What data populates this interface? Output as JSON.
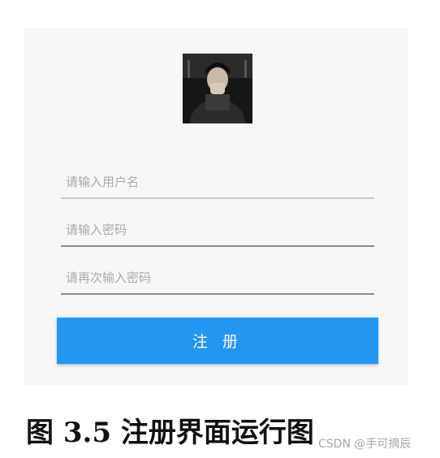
{
  "screen": {
    "avatar_icon": "user-photo",
    "username": {
      "placeholder": "请输入用户名",
      "value": ""
    },
    "password": {
      "placeholder": "请输入密码",
      "value": ""
    },
    "password_confirm": {
      "placeholder": "请再次输入密码",
      "value": ""
    },
    "register_label": "注 册",
    "accent_color": "#2196f3"
  },
  "caption": "图 3.5 注册界面运行图",
  "watermark": "CSDN @手可摘辰"
}
